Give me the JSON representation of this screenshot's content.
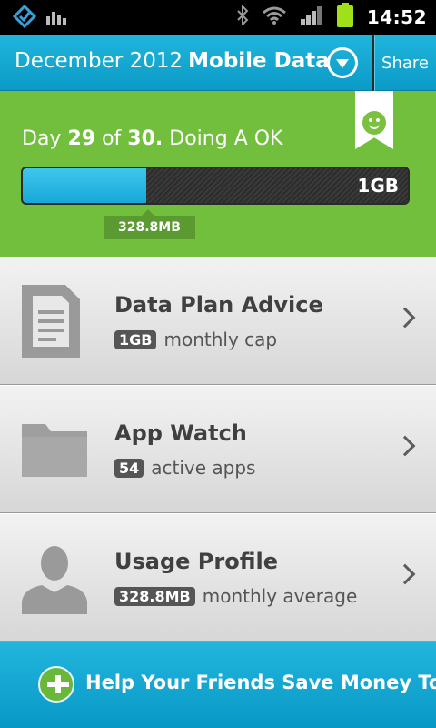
{
  "status_bar": {
    "time": "14:52",
    "icons": [
      "app-notification-icon",
      "signal-bars-notification-icon",
      "bluetooth-icon",
      "wifi-icon",
      "cell-signal-icon",
      "battery-icon"
    ]
  },
  "action_bar": {
    "title_month": "December 2012",
    "title_label": "Mobile Data",
    "share_label": "Share"
  },
  "summary": {
    "day_prefix": "Day",
    "day_current": "29",
    "day_of": "of",
    "day_total": "30.",
    "status_text": "Doing A OK",
    "cap_label": "1GB",
    "used_label": "328.8MB",
    "usage_fraction": 0.32
  },
  "list": [
    {
      "title": "Data Plan Advice",
      "badge": "1GB",
      "subtitle": "monthly cap",
      "icon": "document-icon"
    },
    {
      "title": "App Watch",
      "badge": "54",
      "subtitle": "active apps",
      "icon": "folder-icon"
    },
    {
      "title": "Usage Profile",
      "badge": "328.8MB",
      "subtitle": "monthly average",
      "icon": "person-icon"
    }
  ],
  "banner": {
    "label": "Help Your Friends Save Money Too"
  },
  "colors": {
    "accent_blue": "#13a9d6",
    "summary_green": "#71bf3c",
    "bar_fill": "#2bb9e6"
  }
}
